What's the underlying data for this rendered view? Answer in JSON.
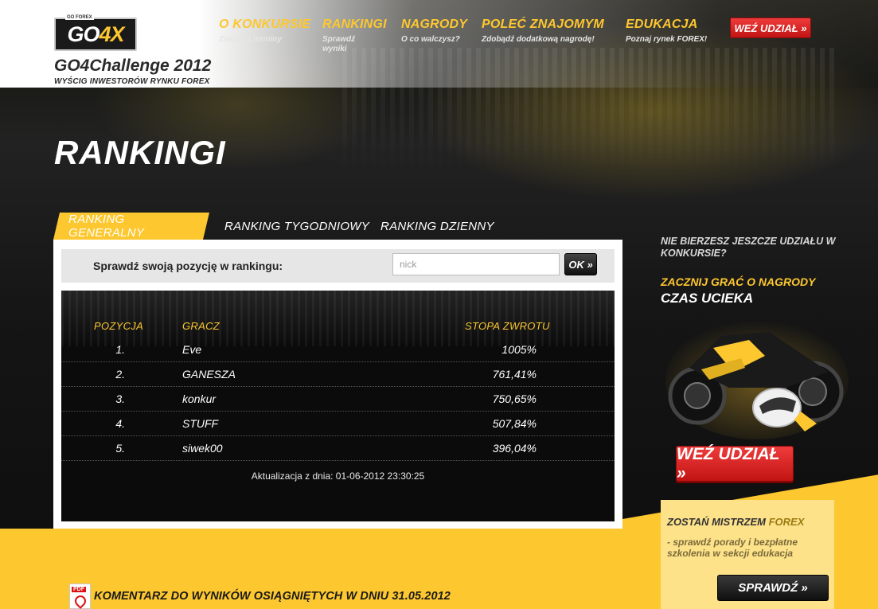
{
  "header": {
    "logo_tag": "GO FOREX",
    "logo_main_a": "GO",
    "logo_main_b": "4X",
    "title": "GO4Challenge 2012",
    "subtitle": "WYŚCIG INWESTORÓW RYNKU FOREX",
    "cta_label": "WEŹ UDZIAŁ »"
  },
  "nav": [
    {
      "label": "O KONKURSIE",
      "desc": "Zasady i terminy"
    },
    {
      "label": "RANKINGI",
      "desc": "Sprawdź wyniki"
    },
    {
      "label": "NAGRODY",
      "desc": "O co walczysz?"
    },
    {
      "label": "POLEĆ ZNAJOMYM",
      "desc": "Zdobądź dodatkową nagrodę!"
    },
    {
      "label": "EDUKACJA",
      "desc": "Poznaj rynek FOREX!"
    }
  ],
  "page": {
    "title": "RANKINGI"
  },
  "tabs": [
    {
      "label": "RANKING GENERALNY",
      "active": true
    },
    {
      "label": "RANKING TYGODNIOWY",
      "active": false
    },
    {
      "label": "RANKING DZIENNY",
      "active": false
    }
  ],
  "search": {
    "label": "Sprawdź swoją pozycję w rankingu:",
    "placeholder": "nick",
    "button": "OK »"
  },
  "table": {
    "headers": {
      "position": "POZYCJA",
      "player": "GRACZ",
      "return": "STOPA ZWROTU"
    },
    "rows": [
      {
        "position": "1.",
        "player": "Eve",
        "return": "1005%"
      },
      {
        "position": "2.",
        "player": "GANESZA",
        "return": "761,41%"
      },
      {
        "position": "3.",
        "player": "konkur",
        "return": "750,65%"
      },
      {
        "position": "4.",
        "player": "STUFF",
        "return": "507,84%"
      },
      {
        "position": "5.",
        "player": "siwek00",
        "return": "396,04%"
      }
    ],
    "updated": "Aktualizacja z dnia: 01-06-2012 23:30:25"
  },
  "sidebar": {
    "question": "NIE BIERZESZ JESZCZE UDZIAŁU W KONKURSIE?",
    "headline1": "ZACZNIJ GRAĆ O NAGRODY",
    "headline2": "CZAS UCIEKA",
    "cta": "WEŹ UDZIAŁ »",
    "edu": {
      "title_a": "ZOSTAŃ MISTRZEM",
      "title_b": "FOREX",
      "desc": "- sprawdź porady i bezpłatne szkolenia w sekcji edukacja",
      "button": "SPRAWDŹ »"
    }
  },
  "footer": {
    "pdf_tag": "PDF",
    "comment": "KOMENTARZ DO WYNIKÓW OSIĄGNIĘTYCH W DNIU 31.05.2012"
  },
  "colors": {
    "accent": "#fdc72f",
    "cta_red": "#d62222",
    "panel_dark": "#0b0b0b"
  }
}
